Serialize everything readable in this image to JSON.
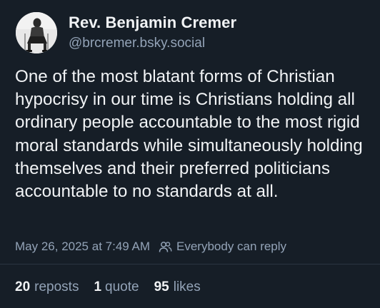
{
  "author": {
    "display_name": "Rev. Benjamin Cremer",
    "handle": "@brcremer.bsky.social"
  },
  "post": {
    "text": "One of the most blatant forms of Christian hypocrisy in our time is Christians holding all ordinary people accountable to the most rigid moral standards while simultaneously holding themselves and their preferred politicians accountable to no standards at all.",
    "timestamp": "May 26, 2025 at 7:49 AM",
    "reply_setting": "Everybody can reply",
    "reply_setting_icon": "people-icon"
  },
  "stats": {
    "reposts_count": "20",
    "reposts_label": "reposts",
    "quotes_count": "1",
    "quotes_label": "quote",
    "likes_count": "95",
    "likes_label": "likes"
  },
  "colors": {
    "background": "#161e27",
    "primary_text": "#f1f3f5",
    "secondary_text": "#93a3b7",
    "divider": "#2a3441"
  }
}
